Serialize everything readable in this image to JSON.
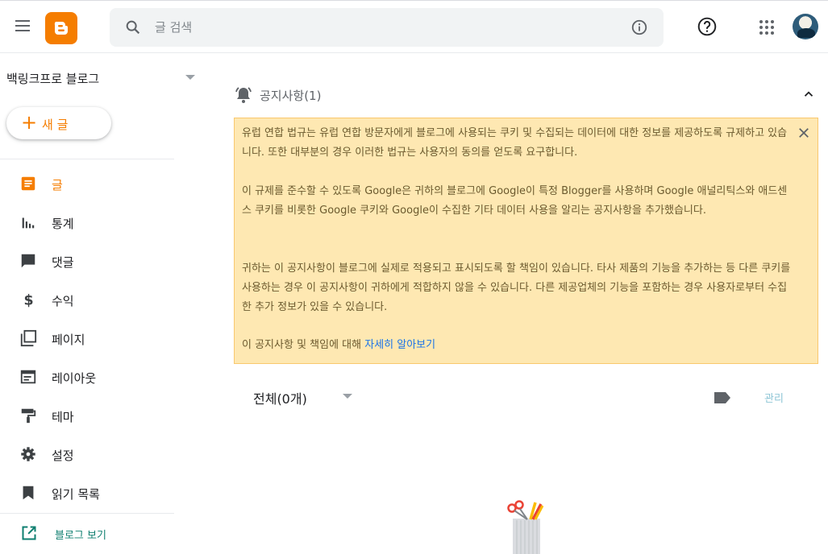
{
  "header": {
    "search_placeholder": "글 검색"
  },
  "sidebar": {
    "blog_name": "백링크프로 블로그",
    "new_post": {
      "plus": "+",
      "label": "새 글"
    },
    "items": [
      {
        "label": "글",
        "icon": "posts-icon"
      },
      {
        "label": "통계",
        "icon": "stats-icon"
      },
      {
        "label": "댓글",
        "icon": "comment-icon"
      },
      {
        "label": "수익",
        "icon": "dollar-icon"
      },
      {
        "label": "페이지",
        "icon": "pages-icon"
      },
      {
        "label": "레이아웃",
        "icon": "layout-icon"
      },
      {
        "label": "테마",
        "icon": "paint-roller-icon"
      },
      {
        "label": "설정",
        "icon": "gear-icon"
      },
      {
        "label": "읽기 목록",
        "icon": "bookmark-icon"
      }
    ],
    "view_blog": "블로그 보기"
  },
  "notice": {
    "title": "공지사항(1)",
    "paragraphs": [
      "유럽 연합 법규는 유럽 연합 방문자에게 블로그에 사용되는 쿠키 및 수집되는 데이터에 대한 정보를 제공하도록 규제하고 있습니다. 또한 대부분의 경우 이러한 법규는 사용자의 동의를 얻도록 요구합니다.",
      "이 규제를 준수할 수 있도록 Google은 귀하의 블로그에 Google이 특정 Blogger를 사용하며 Google 애널리틱스와 애드센스 쿠키를 비롯한 Google 쿠키와 Google이 수집한 기타 데이터 사용을 알리는 공지사항을 추가했습니다.",
      "귀하는 이 공지사항이 블로그에 실제로 적용되고 표시되도록 할 책임이 있습니다. 타사 제품의 기능을 추가하는 등 다른 쿠키를 사용하는 경우 이 공지사항이 귀하에게 적합하지 않을 수 있습니다. 다른 제공업체의 기능을 포함하는 경우 사용자로부터 수집한 추가 정보가 있을 수 있습니다."
    ],
    "last_prefix": "이 공지사항 및 책임에 대해 ",
    "learn_more": "자세히 알아보기"
  },
  "posts": {
    "filter_label": "전체(0개)",
    "manage_label": "관리"
  },
  "colors": {
    "accent": "#f57d00",
    "notice_bg": "#fee8b2",
    "link": "#1a73e8"
  }
}
